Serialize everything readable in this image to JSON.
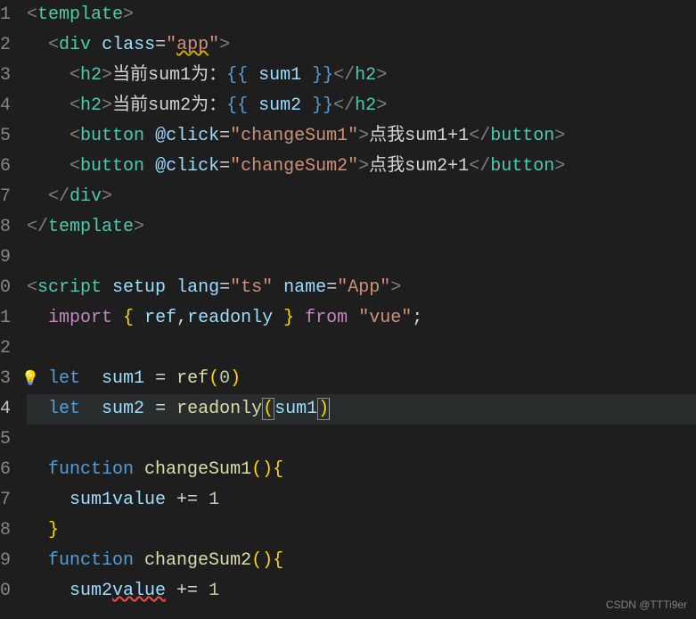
{
  "lineNumbers": [
    "1",
    "2",
    "3",
    "4",
    "5",
    "6",
    "7",
    "8",
    "9",
    "0",
    "1",
    "2",
    "3",
    "4",
    "5",
    "6",
    "7",
    "8",
    "9",
    "0"
  ],
  "currentLine": 14,
  "code": {
    "l1": {
      "tag_open": "<",
      "tag": "template",
      "tag_close": ">"
    },
    "l2": {
      "tag_open": "<",
      "tag": "div",
      "attr": "class",
      "eq": "=",
      "q": "\"",
      "val": "app",
      "q2": "\"",
      "tag_close": ">"
    },
    "l3": {
      "tag_open": "<",
      "tag": "h2",
      "tag_close": ">",
      "text": "当前sum1为：",
      "mo": "{{",
      "sp": " ",
      "var": "sum1",
      "sp2": " ",
      "mc": "}}",
      "etag_open": "</",
      "etag": "h2",
      "etag_close": ">"
    },
    "l4": {
      "tag_open": "<",
      "tag": "h2",
      "tag_close": ">",
      "text": "当前sum2为：",
      "mo": "{{",
      "sp": " ",
      "var": "sum2",
      "sp2": " ",
      "mc": "}}",
      "etag_open": "</",
      "etag": "h2",
      "etag_close": ">"
    },
    "l5": {
      "tag_open": "<",
      "tag": "button",
      "attr": "@click",
      "eq": "=",
      "q": "\"",
      "val": "changeSum1",
      "q2": "\"",
      "tag_close": ">",
      "text": "点我sum1+1",
      "etag_open": "</",
      "etag": "button",
      "etag_close": ">"
    },
    "l6": {
      "tag_open": "<",
      "tag": "button",
      "attr": "@click",
      "eq": "=",
      "q": "\"",
      "val": "changeSum2",
      "q2": "\"",
      "tag_close": ">",
      "text": "点我sum2+1",
      "etag_open": "</",
      "etag": "button",
      "etag_close": ">"
    },
    "l7": {
      "tag_open": "</",
      "tag": "div",
      "tag_close": ">"
    },
    "l8": {
      "tag_open": "</",
      "tag": "template",
      "tag_close": ">"
    },
    "l10": {
      "tag_open": "<",
      "tag": "script",
      "a1": "setup",
      "a2": "lang",
      "eq": "=",
      "q": "\"",
      "v2": "ts",
      "q2": "\"",
      "a3": "name",
      "eq2": "=",
      "q3": "\"",
      "v3": "App",
      "q4": "\"",
      "tag_close": ">"
    },
    "l11": {
      "kw": "import",
      "bo": "{",
      "sp": " ",
      "i1": "ref",
      "comma": ",",
      "i2": "readonly",
      "sp2": " ",
      "bc": "}",
      "from": "from",
      "q": "\"",
      "mod": "vue",
      "q2": "\"",
      "semi": ";"
    },
    "l13": {
      "kw": "let",
      "sp": "  ",
      "var": "sum1",
      "eq": " = ",
      "fn": "ref",
      "po": "(",
      "num": "0",
      "pc": ")"
    },
    "l14": {
      "kw": "let",
      "sp": "  ",
      "var": "sum2",
      "eq": " = ",
      "fn": "readonly",
      "po": "(",
      "arg": "sum1",
      "pc": ")"
    },
    "l16": {
      "kw": "function",
      "sp": " ",
      "fn": "changeSum1",
      "po": "(",
      ")": ")",
      "bo": "{"
    },
    "l17": {
      "obj": "sum1",
      ".": ".",
      "prop": "value",
      "op": " += ",
      "num": "1"
    },
    "l18": {
      "bc": "}"
    },
    "l19": {
      "kw": "function",
      "sp": " ",
      "fn": "changeSum2",
      "po": "(",
      ")": ")",
      "bo": "{"
    },
    "l20": {
      "obj": "sum2",
      ".": ".",
      "prop": "value",
      "op": " += ",
      "num": "1"
    }
  },
  "watermark": "CSDN @TTTi9er"
}
